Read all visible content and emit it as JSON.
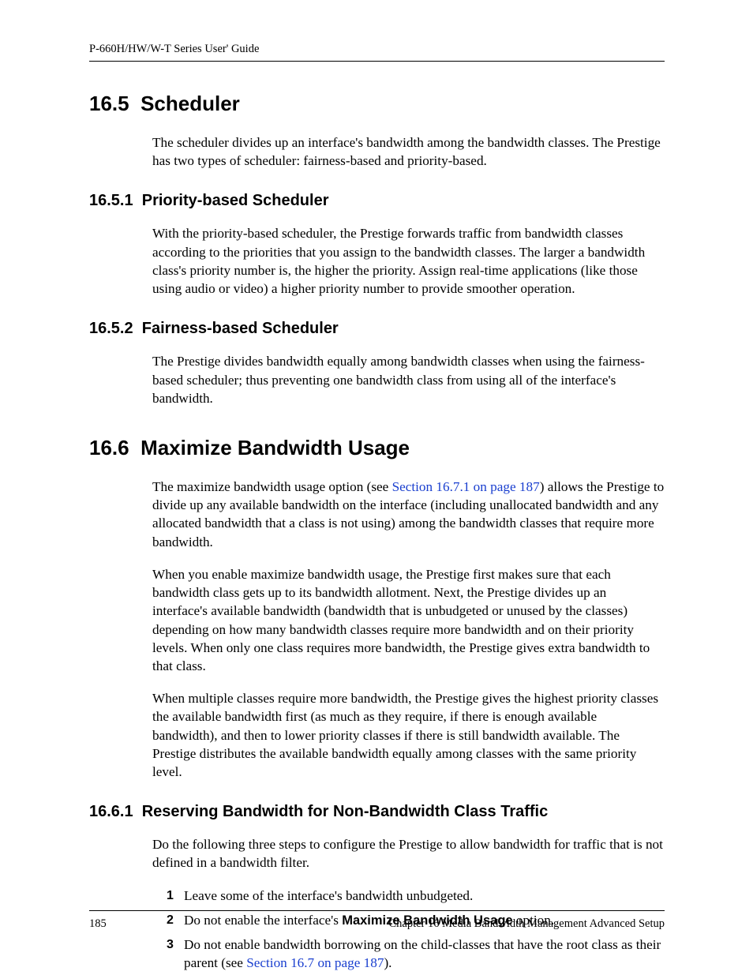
{
  "header": {
    "title": "P-660H/HW/W-T Series User' Guide"
  },
  "sections": {
    "s165": {
      "num": "16.5",
      "title": "Scheduler",
      "intro": "The scheduler divides up an interface's bandwidth among the bandwidth classes. The Prestige has two types of scheduler: fairness-based and priority-based."
    },
    "s1651": {
      "num": "16.5.1",
      "title": "Priority-based Scheduler",
      "body": "With the priority-based scheduler, the Prestige forwards traffic from bandwidth classes according to the priorities that you assign to the bandwidth classes. The larger a bandwidth class's priority number is, the higher the priority. Assign real-time applications (like those using audio or video) a higher priority number to provide smoother operation."
    },
    "s1652": {
      "num": "16.5.2",
      "title": "Fairness-based Scheduler",
      "body": "The Prestige divides bandwidth equally among bandwidth classes when using the fairness-based scheduler; thus preventing one bandwidth class from using all of the interface's bandwidth."
    },
    "s166": {
      "num": "16.6",
      "title": "Maximize Bandwidth Usage",
      "p1a": "The maximize bandwidth usage option (see ",
      "p1link": "Section 16.7.1 on page 187",
      "p1b": ") allows the Prestige to divide up any available bandwidth on the interface (including unallocated bandwidth and any allocated bandwidth that a class is not using) among the bandwidth classes that require more bandwidth.",
      "p2": "When you enable maximize bandwidth usage, the Prestige first makes sure that each bandwidth class gets up to its bandwidth allotment. Next, the Prestige divides up an interface's available bandwidth (bandwidth that is unbudgeted or unused by the classes) depending on how many bandwidth classes require more bandwidth and on their priority levels. When only one class requires more bandwidth, the Prestige gives extra bandwidth to that class.",
      "p3": "When multiple classes require more bandwidth, the Prestige gives the highest priority classes the available bandwidth first (as much as they require, if there is enough available bandwidth), and then to lower priority classes if there is still bandwidth available. The Prestige distributes the available bandwidth equally among classes with the same priority level."
    },
    "s1661": {
      "num": "16.6.1",
      "title": "Reserving Bandwidth for Non-Bandwidth Class Traffic",
      "intro": "Do the following three steps to configure the Prestige to allow bandwidth for traffic that is not defined in a bandwidth filter.",
      "steps": {
        "n1": "1",
        "t1": "Leave some of the interface's bandwidth unbudgeted.",
        "n2": "2",
        "t2a": "Do not enable the interface's ",
        "t2bold": "Maximize Bandwidth Usage",
        "t2b": " option.",
        "n3": "3",
        "t3a": "Do not enable bandwidth borrowing on the child-classes that have the root class as their parent (see ",
        "t3link": "Section 16.7 on page 187",
        "t3b": ")."
      }
    }
  },
  "footer": {
    "page": "185",
    "chapter": "Chapter 16 Media Bandwidth Management Advanced Setup"
  }
}
